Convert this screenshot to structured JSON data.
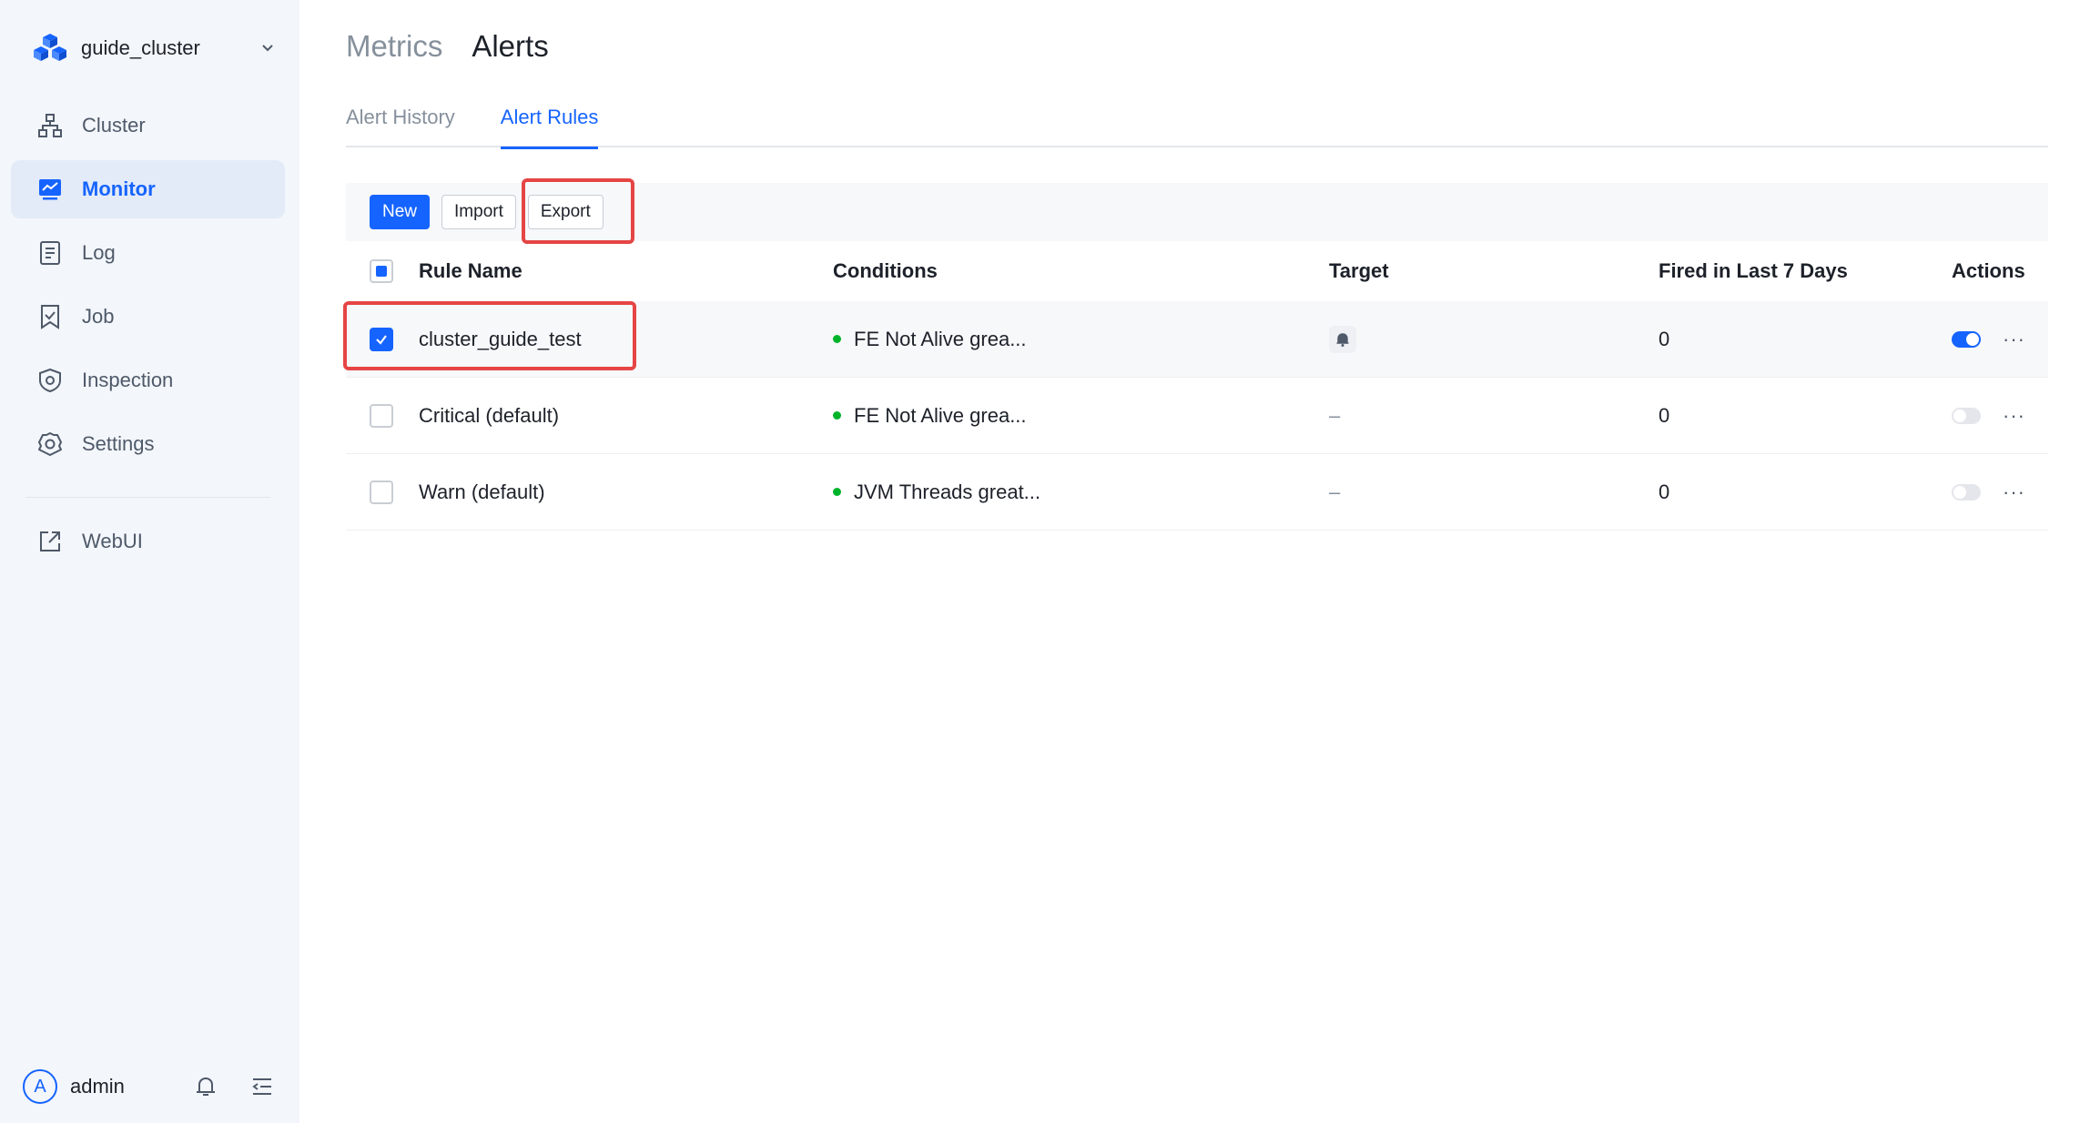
{
  "sidebar": {
    "cluster_name": "guide_cluster",
    "items": [
      {
        "label": "Cluster",
        "icon": "cluster-icon"
      },
      {
        "label": "Monitor",
        "icon": "monitor-icon",
        "active": true
      },
      {
        "label": "Log",
        "icon": "log-icon"
      },
      {
        "label": "Job",
        "icon": "job-icon"
      },
      {
        "label": "Inspection",
        "icon": "inspection-icon"
      },
      {
        "label": "Settings",
        "icon": "gear-icon"
      }
    ],
    "external": {
      "label": "WebUI",
      "icon": "external-link-icon"
    },
    "user": {
      "avatar_letter": "A",
      "name": "admin"
    }
  },
  "main": {
    "page_tabs": [
      {
        "label": "Metrics"
      },
      {
        "label": "Alerts",
        "active": true
      }
    ],
    "sub_tabs": [
      {
        "label": "Alert History"
      },
      {
        "label": "Alert Rules",
        "active": true
      }
    ],
    "toolbar": {
      "new_label": "New",
      "import_label": "Import",
      "export_label": "Export"
    },
    "table": {
      "headers": {
        "name": "Rule Name",
        "conditions": "Conditions",
        "target": "Target",
        "fired": "Fired in Last 7 Days",
        "actions": "Actions"
      },
      "rows": [
        {
          "name": "cluster_guide_test",
          "condition": "FE Not Alive grea...",
          "target": "bell-icon",
          "fired": "0",
          "enabled": true,
          "checked": true
        },
        {
          "name": "Critical (default)",
          "condition": "FE Not Alive grea...",
          "target": "–",
          "fired": "0",
          "enabled": false,
          "checked": false
        },
        {
          "name": "Warn (default)",
          "condition": "JVM Threads great...",
          "target": "–",
          "fired": "0",
          "enabled": false,
          "checked": false
        }
      ]
    }
  },
  "colors": {
    "accent": "#1664ff",
    "highlight": "#e54545",
    "status_ok": "#00b42a"
  }
}
